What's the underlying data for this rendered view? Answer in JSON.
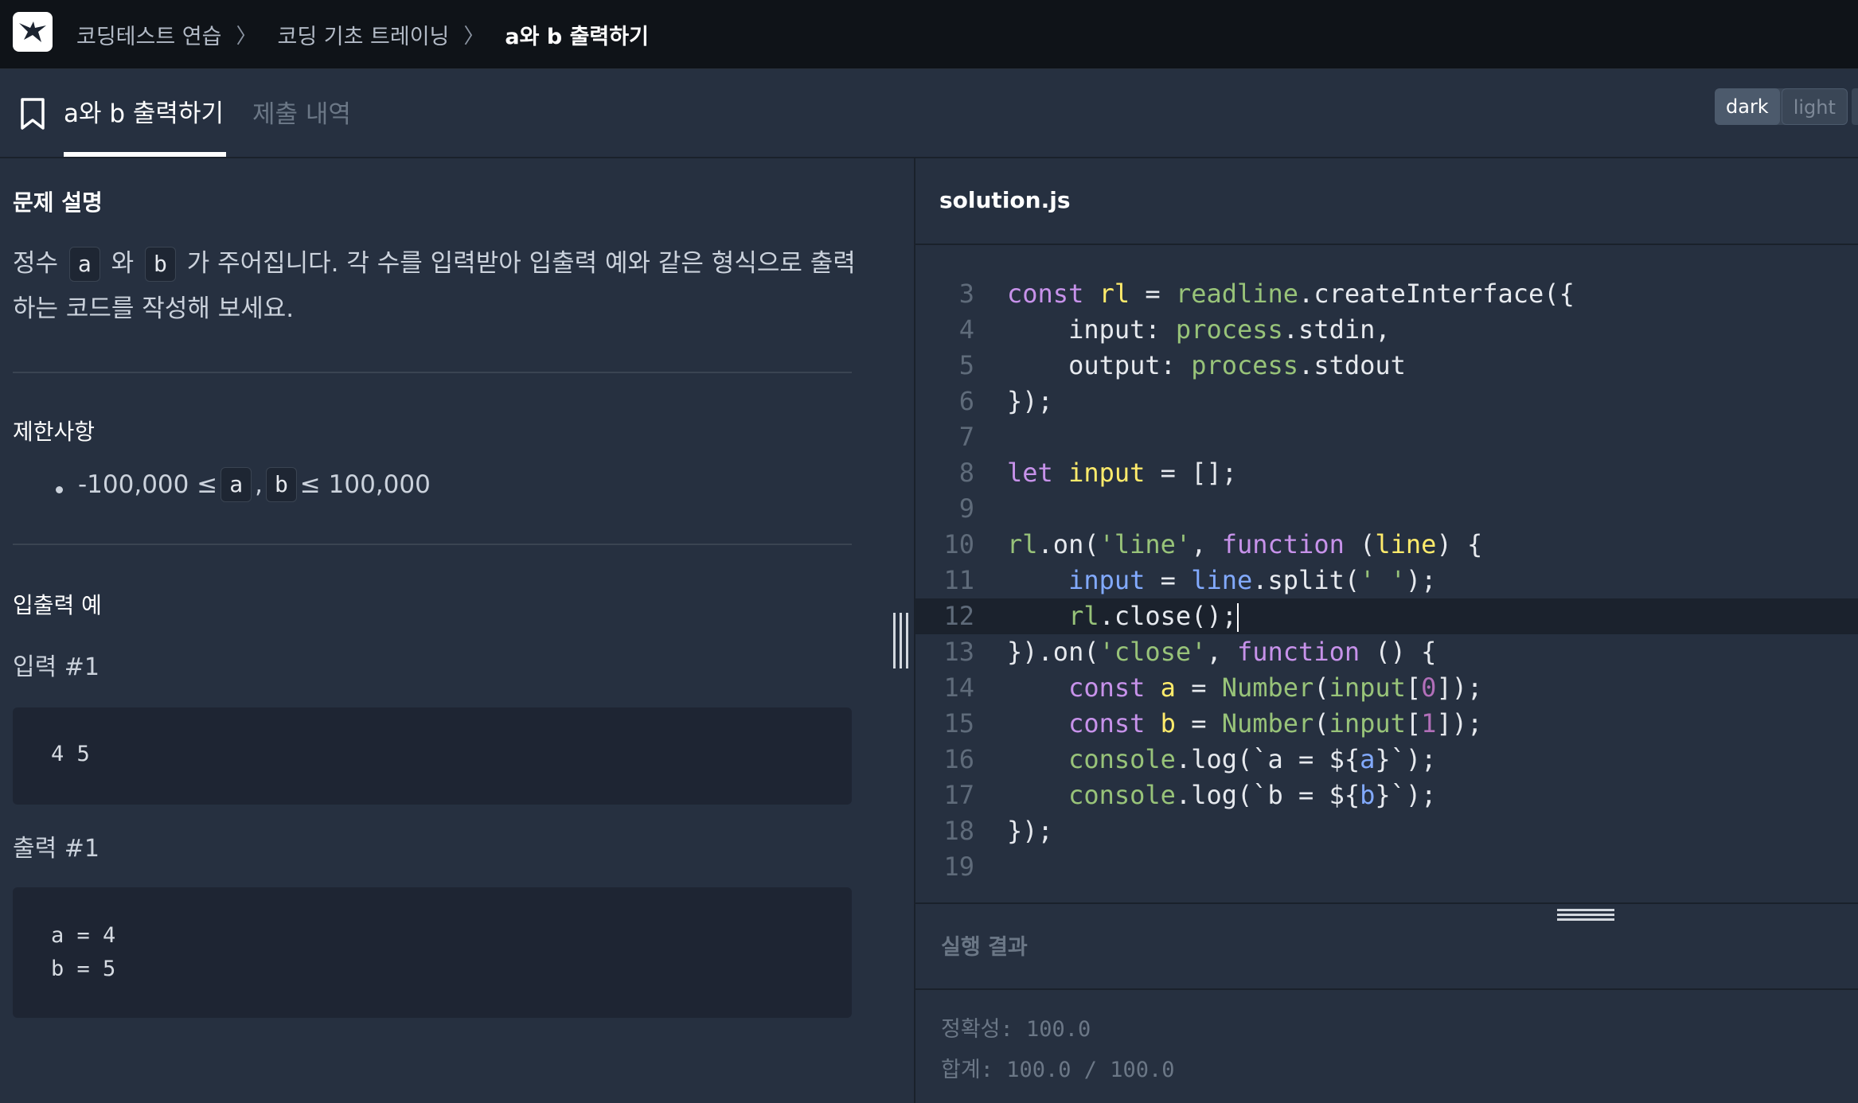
{
  "breadcrumb": {
    "items": [
      "코딩테스트 연습",
      "코딩 기초 트레이닝",
      "a와 b 출력하기"
    ],
    "separator": "〉"
  },
  "tabs": {
    "active": "a와 b 출력하기",
    "history": "제출 내역"
  },
  "theme": {
    "dark": "dark",
    "light": "light"
  },
  "problem": {
    "description_title": "문제 설명",
    "description_parts": [
      "정수 ",
      "a",
      " 와 ",
      "b",
      " 가 주어집니다. 각 수를 입력받아 입출력 예와 같은 형식으로 출력하는 코드를 작성해 보세요."
    ],
    "constraints_title": "제한사항",
    "constraint_parts": [
      "-100,000 ≤ ",
      "a",
      ", ",
      "b",
      " ≤ 100,000"
    ],
    "io_title": "입출력 예",
    "input_label": "입력 #1",
    "input_lines": [
      "4 5"
    ],
    "output_label": "출력 #1",
    "output_lines": [
      "a = 4",
      "b = 5"
    ]
  },
  "editor": {
    "file_name": "solution.js",
    "active_line": 12,
    "line_numbers": [
      "3",
      "4",
      "5",
      "6",
      "7",
      "8",
      "9",
      "10",
      "11",
      "12",
      "13",
      "14",
      "15",
      "16",
      "17",
      "18",
      "19"
    ]
  },
  "result": {
    "title": "실행 결과",
    "accuracy": "정확성: 100.0",
    "total": "합계: 100.0 / 100.0"
  },
  "colors": {
    "background": "#263040",
    "topbar": "#0f1318",
    "keyword": "#c792ea",
    "string": "#98c379",
    "definition": "#ffeb6b"
  }
}
